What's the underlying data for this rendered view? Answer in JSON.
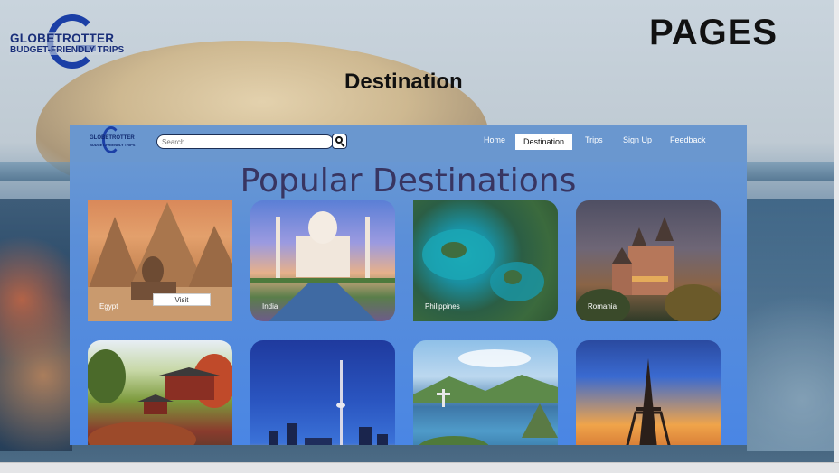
{
  "slide": {
    "logo_line1": "GLOBETROTTER",
    "logo_line2": "BUDGET-FRIENDLY TRIPS",
    "heading": "PAGES",
    "subtitle": "Destination"
  },
  "site": {
    "logo_line1": "GLOBETROTTER",
    "logo_line2": "BUDGET-FRIENDLY TRIPS",
    "search": {
      "placeholder": "Search.."
    },
    "nav": {
      "home": "Home",
      "destination": "Destination",
      "trips": "Trips",
      "signup": "Sign Up",
      "feedback": "Feedback"
    },
    "page_title": "Popular Destinations",
    "cards": [
      {
        "caption": "Egypt",
        "button": "Visit"
      },
      {
        "caption": "India"
      },
      {
        "caption": "Philippines"
      },
      {
        "caption": "Romania"
      },
      {
        "caption": ""
      },
      {
        "caption": ""
      },
      {
        "caption": ""
      },
      {
        "caption": ""
      }
    ]
  },
  "colors": {
    "nav_bg": "#6a97cf",
    "page_bg": "#4a86e4",
    "title_text": "#383561",
    "logo_blue": "#1b3fa6"
  }
}
